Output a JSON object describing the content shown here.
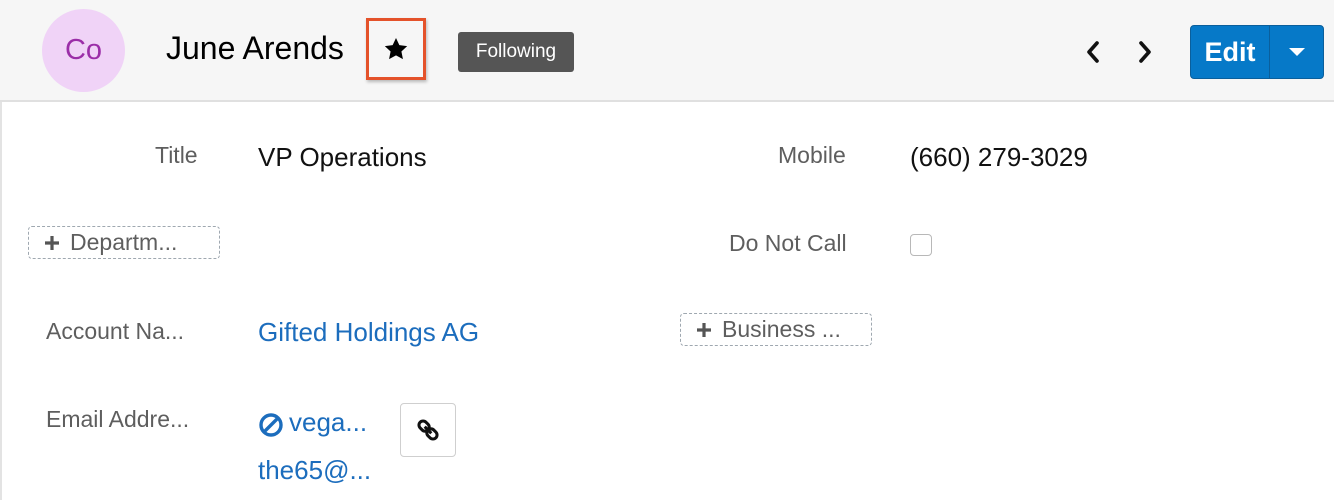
{
  "header": {
    "avatar_initials": "Co",
    "record_name": "June Arends",
    "favorite_icon": "star-icon",
    "status_badge": "Following",
    "prev_icon": "chevron-left-icon",
    "next_icon": "chevron-right-icon",
    "edit_label": "Edit",
    "edit_dropdown_icon": "caret-down-icon"
  },
  "fields": {
    "title": {
      "label": "Title",
      "value": "VP Operations"
    },
    "mobile": {
      "label": "Mobile",
      "value": "(660) 279-3029"
    },
    "department": {
      "add_label": "Departm..."
    },
    "do_not_call": {
      "label": "Do Not Call",
      "checked": false
    },
    "account_name": {
      "label": "Account Na...",
      "value": "Gifted Holdings AG"
    },
    "business_center": {
      "add_label": "Business ..."
    },
    "email": {
      "label": "Email Addre...",
      "value1": "vega...",
      "value2": "the65@...",
      "opt_out_icon": "opt-out-icon",
      "link_icon": "link-icon"
    }
  },
  "colors": {
    "accent": "#0679c8",
    "link": "#1c6dbd",
    "highlight": "#e4522a",
    "badge": "#555555",
    "avatar_bg": "#f0d3f7"
  }
}
